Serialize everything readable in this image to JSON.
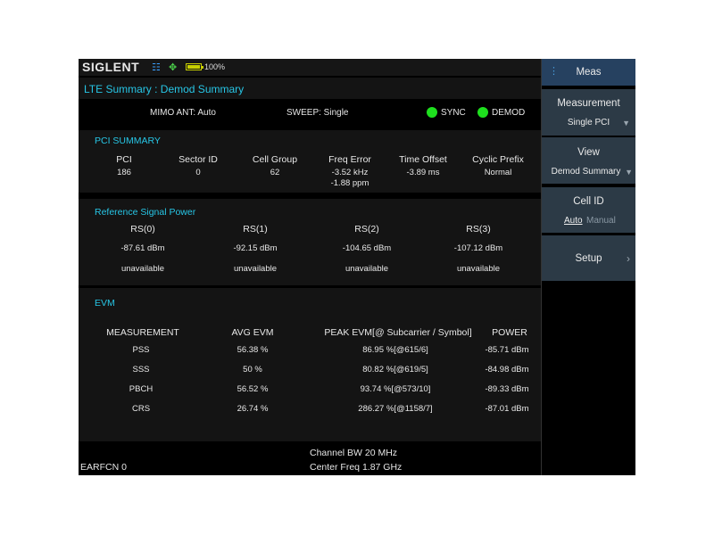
{
  "topbar": {
    "brand": "SIGLENT",
    "battery_pct": "100%",
    "battery_level": 1.0
  },
  "title": "LTE Summary : Demod Summary",
  "status": {
    "mimo": "MIMO ANT: Auto",
    "sweep": "SWEEP: Single",
    "sync": "SYNC",
    "demod": "DEMOD",
    "indicator_color": "#1ee01e"
  },
  "pci_summary": {
    "title": "PCI SUMMARY",
    "headers": [
      "PCI",
      "Sector ID",
      "Cell Group",
      "Freq Error",
      "Time Offset",
      "Cyclic Prefix"
    ],
    "values": [
      "186",
      "0",
      "62",
      "-3.52 kHz",
      "-3.89 ms",
      "Normal"
    ],
    "freq_error_ppm": "-1.88 ppm"
  },
  "ref_signal_power": {
    "title": "Reference Signal Power",
    "headers": [
      "RS(0)",
      "RS(1)",
      "RS(2)",
      "RS(3)"
    ],
    "power": [
      "-87.61 dBm",
      "-92.15 dBm",
      "-104.65 dBm",
      "-107.12 dBm"
    ],
    "status": [
      "unavailable",
      "unavailable",
      "unavailable",
      "unavailable"
    ]
  },
  "evm": {
    "title": "EVM",
    "headers": [
      "MEASUREMENT",
      "AVG EVM",
      "PEAK EVM[@ Subcarrier / Symbol]",
      "POWER"
    ],
    "rows": [
      [
        "PSS",
        "56.38 %",
        "86.95 %[@615/6]",
        "-85.71 dBm"
      ],
      [
        "SSS",
        "50 %",
        "80.82 %[@619/5]",
        "-84.98 dBm"
      ],
      [
        "PBCH",
        "56.52 %",
        "93.74 %[@573/10]",
        "-89.33 dBm"
      ],
      [
        "CRS",
        "26.74 %",
        "286.27 %[@1158/7]",
        "-87.01 dBm"
      ]
    ]
  },
  "bottom": {
    "earfcn": "EARFCN  0",
    "channel_bw": "Channel BW  20 MHz",
    "center_freq": "Center Freq  1.87 GHz"
  },
  "menu": {
    "title": "Meas",
    "measurement": {
      "label": "Measurement",
      "value": "Single PCI"
    },
    "view": {
      "label": "View",
      "value": "Demod Summary"
    },
    "cell_id": {
      "label": "Cell ID",
      "auto": "Auto",
      "manual": "Manual"
    },
    "setup": {
      "label": "Setup"
    }
  },
  "colors": {
    "accent": "#27c6e6",
    "menu_bg": "#2c3a46",
    "menu_active": "#264160",
    "panel_bg": "#141414"
  }
}
